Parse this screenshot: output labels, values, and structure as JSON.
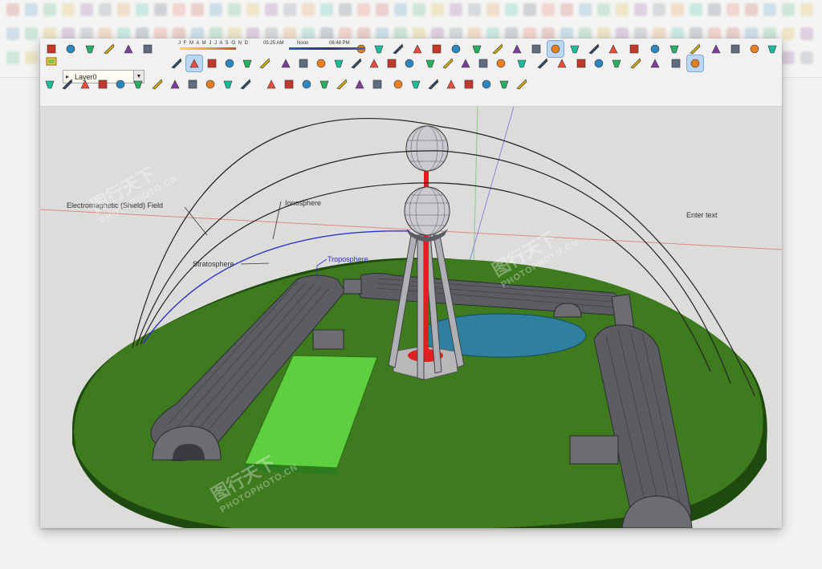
{
  "layer_select": {
    "value": "Layer0"
  },
  "shadow_settings": {
    "months": "J F M A M J J A S O N D",
    "time_start": "05:25 AM",
    "time_mid": "Noon",
    "time_end": "06:48 PM"
  },
  "scene_labels": {
    "em_shield": "Electromagnetic (Shield) Field",
    "ionosphere": "Ionosphere",
    "stratosphere": "Stratosphere",
    "troposphere": "Troposphere",
    "enter_text": "Enter text"
  },
  "watermark": {
    "text": "图行天下",
    "url": "PHOTOPHOTO.CN"
  },
  "colors": {
    "ground": "#3e7a1e",
    "ground_side": "#1f4a0f",
    "pool": "#2e7fa0",
    "tower_core": "#e02020",
    "hangar": "#5b5d63",
    "pad": "#5ecf3e",
    "troposphere_line": "#3030c8"
  },
  "toolbar_icons": [
    "select-tool",
    "eraser-tool",
    "paint-bucket-tool",
    "line-tool",
    "arc-tool",
    "rectangle-tool",
    "circle-tool",
    "polygon-tool",
    "freehand-tool",
    "move-tool",
    "push-pull-tool",
    "rotate-tool",
    "follow-me-tool",
    "scale-tool",
    "offset-tool",
    "tape-measure-tool",
    "dimension-tool",
    "protractor-tool",
    "text-tool",
    "axes-tool",
    "3d-text-tool",
    "orbit-tool",
    "pan-tool",
    "zoom-tool",
    "zoom-window-tool",
    "zoom-extents-tool",
    "position-camera-tool",
    "walk-tool",
    "look-around-tool",
    "section-plane-tool",
    "iso-view",
    "top-view",
    "front-view",
    "right-view",
    "back-view",
    "left-view",
    "xray-style",
    "wireframe-style",
    "hidden-line-style",
    "shaded-style",
    "textured-style",
    "monochrome-style"
  ]
}
